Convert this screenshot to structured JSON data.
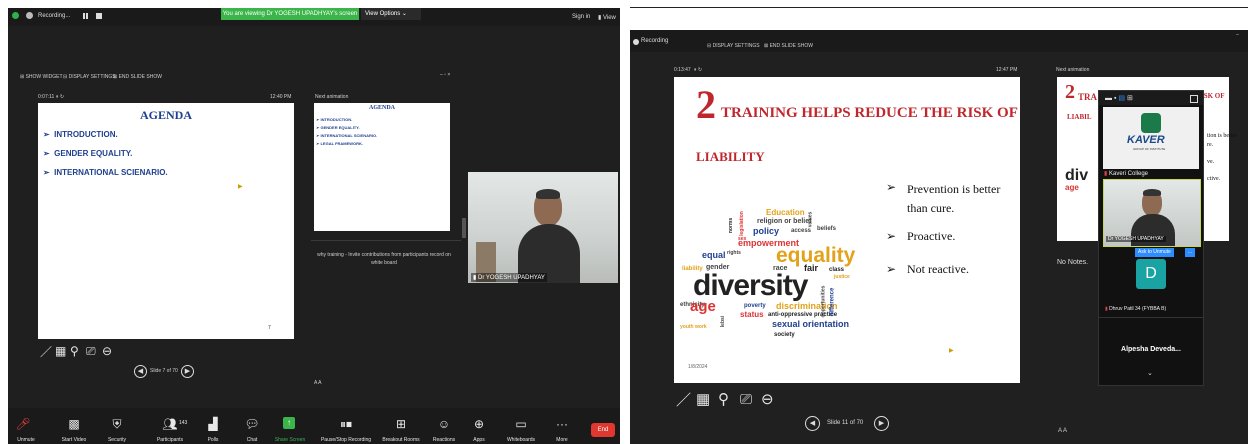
{
  "left": {
    "recording_label": "Recording...",
    "viewing_banner": "You are viewing Dr YOGESH UPADHYAY's screen",
    "view_options": "View Options",
    "sign_in": "Sign in",
    "view": "View",
    "toolbar_small": [
      "SHOW WIDGET",
      "DISPLAY SETTINGS",
      "END SLIDE SHOW"
    ],
    "timer": "0:07:11",
    "clock": "12:40 PM",
    "next_animation": "Next animation",
    "slide": {
      "title": "AGENDA",
      "items": [
        "INTRODUCTION.",
        "GENDER EQUALITY.",
        "INTERNATIONAL SCIENARIO."
      ],
      "page_number": "7"
    },
    "next_slide": {
      "title": "AGENDA",
      "items": [
        "INTRODUCTION.",
        "GENDER EQUALITY.",
        "INTERNATIONAL SCIENARIO.",
        "LEGAL FRAMEWORK."
      ]
    },
    "notes": "why training - Invite contributions from participants record on white board",
    "slide_counter": "Slide 7 of 70",
    "participant_name": "Dr YOGESH UPADHYAY",
    "participants_count": "143",
    "bottom_toolbar": [
      "Unmute",
      "Start Video",
      "Security",
      "Participants",
      "Polls",
      "Chat",
      "Share Screen",
      "Pause/Stop Recording",
      "Breakout Rooms",
      "Reactions",
      "Apps",
      "Whiteboards",
      "More"
    ],
    "end_label": "End"
  },
  "right": {
    "recording_label": "Recording",
    "toolbar_small": [
      "DISPLAY SETTINGS",
      "END SLIDE SHOW"
    ],
    "timer": "0:13:47",
    "clock": "12:47 PM",
    "next_animation": "Next animation",
    "slide": {
      "number_glyph": "2",
      "title_line1": "TRAINING HELPS REDUCE THE  RISK OF",
      "title_line2": "LIABILITY",
      "bullets": [
        "Prevention is better than cure.",
        "Proactive.",
        "Not reactive."
      ],
      "date": "1/8/2024"
    },
    "next_slide_fragments": {
      "glyph": "2",
      "tra": "TRA",
      "risk": "ISK OF",
      "liab": "LIABIL",
      "b1": "tion is better",
      "b2": "re.",
      "b3": "ve.",
      "b4": "ctive."
    },
    "notes": "No Notes.",
    "slide_counter": "Slide 11 of 70",
    "gallery": {
      "college_name": "Kaveri College",
      "logo_text": "KAVER",
      "logo_sub": "GROUP OF INSTITUTE",
      "teacher_name": "Dr YOGESH UPADHYAY",
      "ask_unmute": "Ask to Unmute",
      "ask_more": "...",
      "avatar_letter": "D",
      "dhruv_name": "Dhruv Patil 34 (FYBBA B)",
      "alpesha_name": "Alpesha Deveda..."
    }
  },
  "wordcloud": [
    "Education",
    "religion or belief",
    "policy",
    "access",
    "beliefs",
    "empowerment",
    "equal",
    "rights",
    "sex",
    "equality",
    "liability",
    "gender",
    "race",
    "fair",
    "class",
    "justice",
    "diversity",
    "ethnicity",
    "age",
    "discrimination",
    "anti-oppressive practice",
    "youth work",
    "status",
    "poverty",
    "sexual orientation",
    "society",
    "norms",
    "legislation",
    "values",
    "opportunities",
    "difference",
    "lebsi"
  ],
  "colors": {
    "green_banner": "#3bb54a",
    "end_red": "#e0372f",
    "slide_red": "#c0272d",
    "agenda_blue": "#1f3f8f",
    "ask_blue": "#2d8cff",
    "avatar_teal": "#1aa3a3"
  }
}
